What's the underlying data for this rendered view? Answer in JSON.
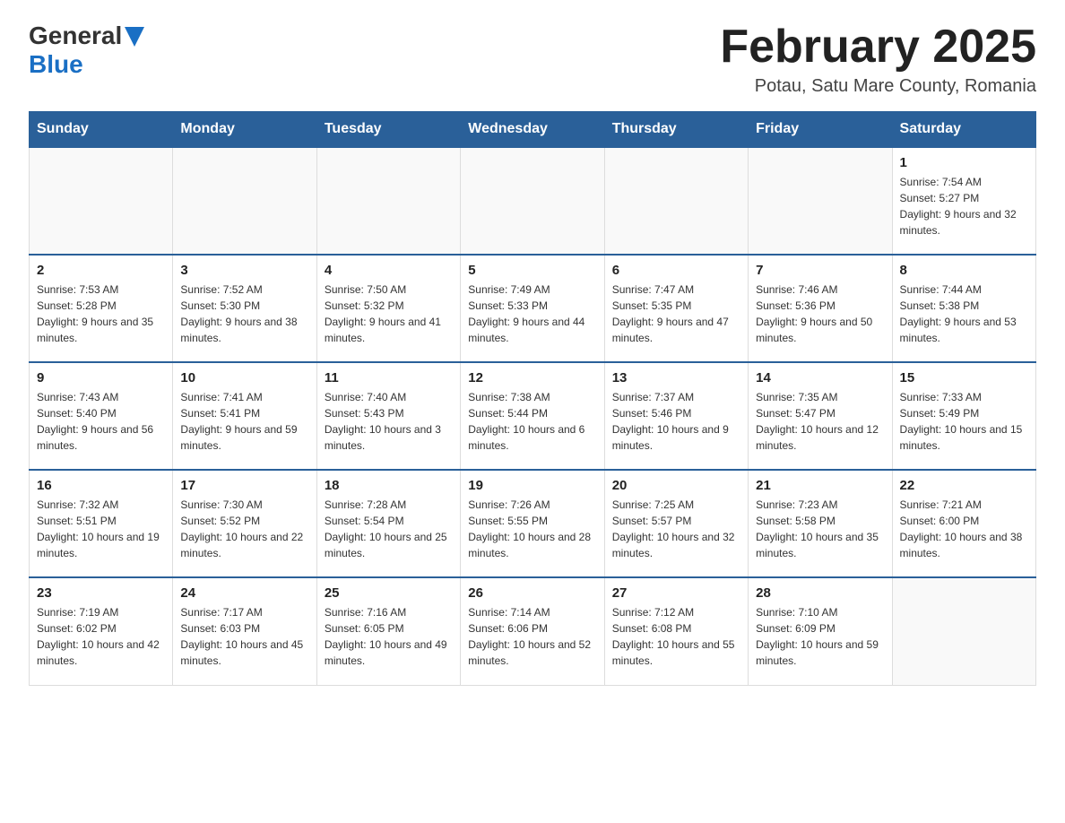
{
  "header": {
    "title": "February 2025",
    "subtitle": "Potau, Satu Mare County, Romania",
    "logo": {
      "general": "General",
      "blue": "Blue"
    }
  },
  "days_of_week": [
    "Sunday",
    "Monday",
    "Tuesday",
    "Wednesday",
    "Thursday",
    "Friday",
    "Saturday"
  ],
  "weeks": [
    [
      {
        "day": "",
        "info": ""
      },
      {
        "day": "",
        "info": ""
      },
      {
        "day": "",
        "info": ""
      },
      {
        "day": "",
        "info": ""
      },
      {
        "day": "",
        "info": ""
      },
      {
        "day": "",
        "info": ""
      },
      {
        "day": "1",
        "info": "Sunrise: 7:54 AM\nSunset: 5:27 PM\nDaylight: 9 hours and 32 minutes."
      }
    ],
    [
      {
        "day": "2",
        "info": "Sunrise: 7:53 AM\nSunset: 5:28 PM\nDaylight: 9 hours and 35 minutes."
      },
      {
        "day": "3",
        "info": "Sunrise: 7:52 AM\nSunset: 5:30 PM\nDaylight: 9 hours and 38 minutes."
      },
      {
        "day": "4",
        "info": "Sunrise: 7:50 AM\nSunset: 5:32 PM\nDaylight: 9 hours and 41 minutes."
      },
      {
        "day": "5",
        "info": "Sunrise: 7:49 AM\nSunset: 5:33 PM\nDaylight: 9 hours and 44 minutes."
      },
      {
        "day": "6",
        "info": "Sunrise: 7:47 AM\nSunset: 5:35 PM\nDaylight: 9 hours and 47 minutes."
      },
      {
        "day": "7",
        "info": "Sunrise: 7:46 AM\nSunset: 5:36 PM\nDaylight: 9 hours and 50 minutes."
      },
      {
        "day": "8",
        "info": "Sunrise: 7:44 AM\nSunset: 5:38 PM\nDaylight: 9 hours and 53 minutes."
      }
    ],
    [
      {
        "day": "9",
        "info": "Sunrise: 7:43 AM\nSunset: 5:40 PM\nDaylight: 9 hours and 56 minutes."
      },
      {
        "day": "10",
        "info": "Sunrise: 7:41 AM\nSunset: 5:41 PM\nDaylight: 9 hours and 59 minutes."
      },
      {
        "day": "11",
        "info": "Sunrise: 7:40 AM\nSunset: 5:43 PM\nDaylight: 10 hours and 3 minutes."
      },
      {
        "day": "12",
        "info": "Sunrise: 7:38 AM\nSunset: 5:44 PM\nDaylight: 10 hours and 6 minutes."
      },
      {
        "day": "13",
        "info": "Sunrise: 7:37 AM\nSunset: 5:46 PM\nDaylight: 10 hours and 9 minutes."
      },
      {
        "day": "14",
        "info": "Sunrise: 7:35 AM\nSunset: 5:47 PM\nDaylight: 10 hours and 12 minutes."
      },
      {
        "day": "15",
        "info": "Sunrise: 7:33 AM\nSunset: 5:49 PM\nDaylight: 10 hours and 15 minutes."
      }
    ],
    [
      {
        "day": "16",
        "info": "Sunrise: 7:32 AM\nSunset: 5:51 PM\nDaylight: 10 hours and 19 minutes."
      },
      {
        "day": "17",
        "info": "Sunrise: 7:30 AM\nSunset: 5:52 PM\nDaylight: 10 hours and 22 minutes."
      },
      {
        "day": "18",
        "info": "Sunrise: 7:28 AM\nSunset: 5:54 PM\nDaylight: 10 hours and 25 minutes."
      },
      {
        "day": "19",
        "info": "Sunrise: 7:26 AM\nSunset: 5:55 PM\nDaylight: 10 hours and 28 minutes."
      },
      {
        "day": "20",
        "info": "Sunrise: 7:25 AM\nSunset: 5:57 PM\nDaylight: 10 hours and 32 minutes."
      },
      {
        "day": "21",
        "info": "Sunrise: 7:23 AM\nSunset: 5:58 PM\nDaylight: 10 hours and 35 minutes."
      },
      {
        "day": "22",
        "info": "Sunrise: 7:21 AM\nSunset: 6:00 PM\nDaylight: 10 hours and 38 minutes."
      }
    ],
    [
      {
        "day": "23",
        "info": "Sunrise: 7:19 AM\nSunset: 6:02 PM\nDaylight: 10 hours and 42 minutes."
      },
      {
        "day": "24",
        "info": "Sunrise: 7:17 AM\nSunset: 6:03 PM\nDaylight: 10 hours and 45 minutes."
      },
      {
        "day": "25",
        "info": "Sunrise: 7:16 AM\nSunset: 6:05 PM\nDaylight: 10 hours and 49 minutes."
      },
      {
        "day": "26",
        "info": "Sunrise: 7:14 AM\nSunset: 6:06 PM\nDaylight: 10 hours and 52 minutes."
      },
      {
        "day": "27",
        "info": "Sunrise: 7:12 AM\nSunset: 6:08 PM\nDaylight: 10 hours and 55 minutes."
      },
      {
        "day": "28",
        "info": "Sunrise: 7:10 AM\nSunset: 6:09 PM\nDaylight: 10 hours and 59 minutes."
      },
      {
        "day": "",
        "info": ""
      }
    ]
  ]
}
